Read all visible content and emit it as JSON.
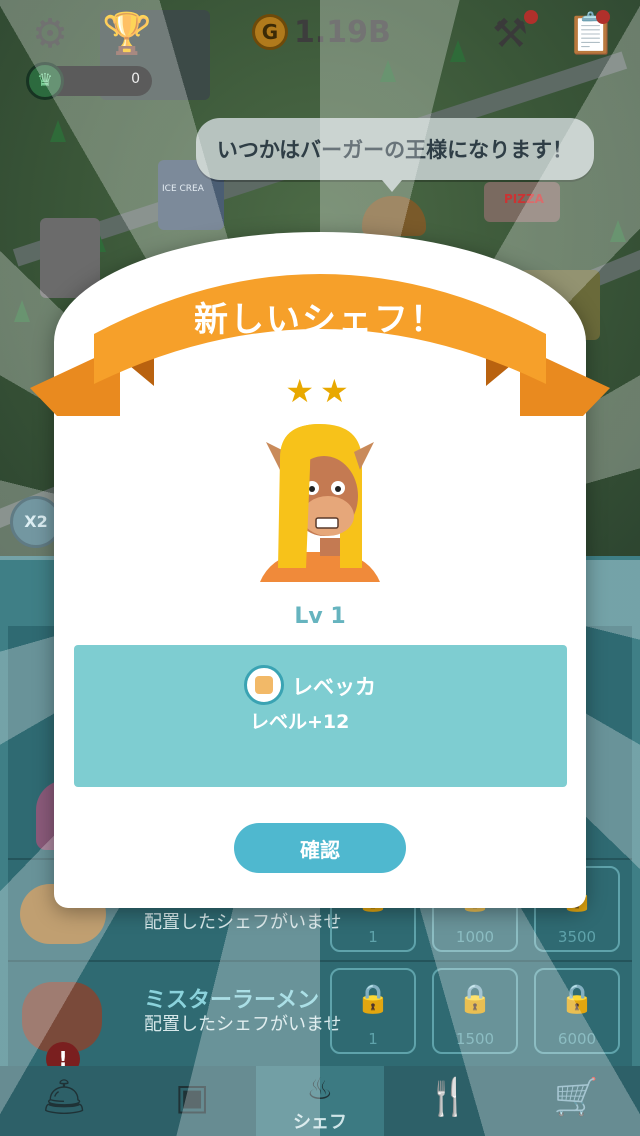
{
  "hud": {
    "gold_symbol": "G",
    "gold_amount": "1.19B",
    "crown_count": "0"
  },
  "speech_bubble": "いつかはバーガーの王様になります！",
  "boost_button": "X2",
  "map_signs": {
    "pizza": "PIZZA",
    "ice_cream": "ICE CREA"
  },
  "restaurants": [
    {
      "title": "",
      "subtitle": "",
      "slots": []
    },
    {
      "title": "",
      "subtitle": "配置したシェフがいませ",
      "slots": [
        "1",
        "1000",
        "3500"
      ]
    },
    {
      "title": "ミスターラーメン",
      "subtitle": "配置したシェフがいませ",
      "slots": [
        "1",
        "1500",
        "6000"
      ]
    }
  ],
  "nav": {
    "chef_label": "シェフ"
  },
  "modal": {
    "title": "新しいシェフ！",
    "stars": "★★",
    "level": "Lv 1",
    "skill_name": "レベッカ",
    "skill_effect": "レベル+12",
    "confirm_label": "確認"
  },
  "colors": {
    "ribbon": "#f6a02a",
    "skill_panel": "#7ecdd1",
    "confirm_button": "#4fb8cf",
    "level_text": "#66b4bf"
  }
}
